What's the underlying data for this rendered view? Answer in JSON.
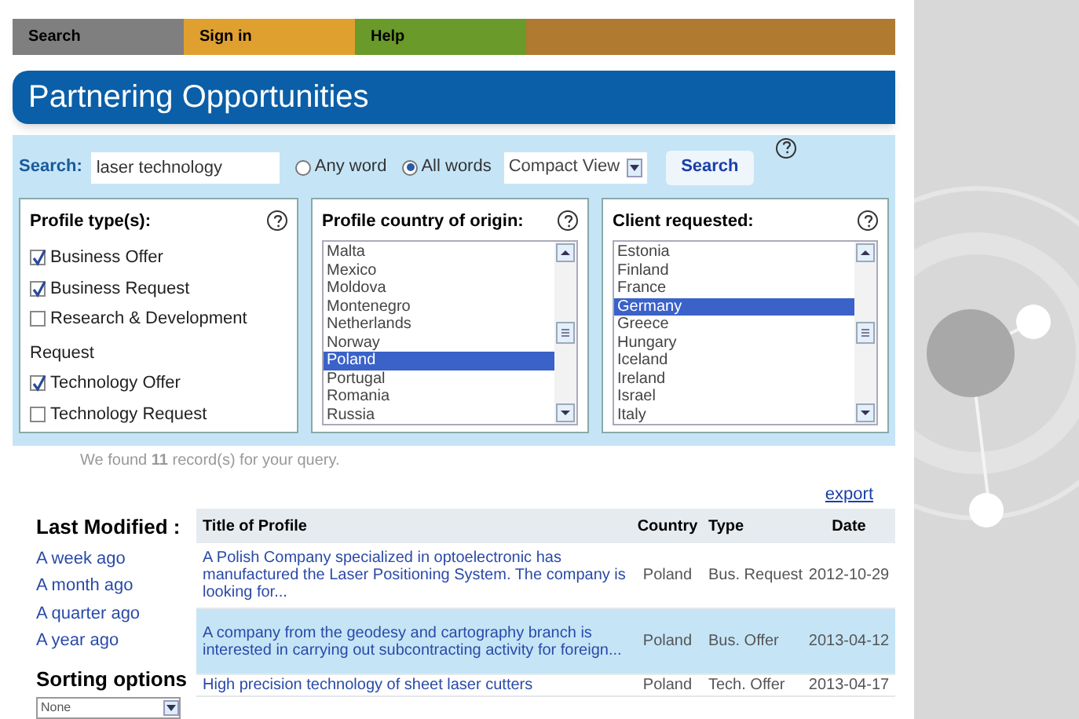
{
  "nav": [
    {
      "label": "Search",
      "kind": "search"
    },
    {
      "label": "Sign in",
      "kind": "signin"
    },
    {
      "label": "Help",
      "kind": "help"
    }
  ],
  "title": "Partnering Opportunities",
  "search": {
    "label": "Search:",
    "value": "laser technology",
    "modes": [
      {
        "label": "Any word",
        "selected": false
      },
      {
        "label": "All words",
        "selected": true
      }
    ],
    "view": "Compact View",
    "button": "Search"
  },
  "profile_types": {
    "title": "Profile type(s):",
    "items": [
      {
        "label": "Business Offer",
        "checked": true
      },
      {
        "label": "Business Request",
        "checked": true
      },
      {
        "label": "Research & Development",
        "checked": false
      },
      {
        "label": "Request",
        "kind": "heading"
      },
      {
        "label": "Technology Offer",
        "checked": true
      },
      {
        "label": "Technology Request",
        "checked": false
      }
    ]
  },
  "country_of_origin": {
    "title": "Profile country of origin:",
    "options": [
      {
        "label": "Malta",
        "selected": false
      },
      {
        "label": "Mexico",
        "selected": false
      },
      {
        "label": "Moldova",
        "selected": false
      },
      {
        "label": "Montenegro",
        "selected": false
      },
      {
        "label": "Netherlands",
        "selected": false
      },
      {
        "label": "Norway",
        "selected": false
      },
      {
        "label": "Poland",
        "selected": true
      },
      {
        "label": "Portugal",
        "selected": false
      },
      {
        "label": "Romania",
        "selected": false
      },
      {
        "label": "Russia",
        "selected": false
      }
    ]
  },
  "client_requested": {
    "title": "Client requested:",
    "options": [
      {
        "label": "Estonia",
        "selected": false
      },
      {
        "label": "Finland",
        "selected": false
      },
      {
        "label": "France",
        "selected": false
      },
      {
        "label": "Germany",
        "selected": true
      },
      {
        "label": "Greece",
        "selected": false
      },
      {
        "label": "Hungary",
        "selected": false
      },
      {
        "label": "Iceland",
        "selected": false
      },
      {
        "label": "Ireland",
        "selected": false
      },
      {
        "label": "Israel",
        "selected": false
      },
      {
        "label": "Italy",
        "selected": false
      }
    ]
  },
  "result_summary": "We found **11** record(s) for your query.",
  "export": "export",
  "last_modified": {
    "title": "Last Modified :",
    "links": [
      "A week ago",
      "A month ago",
      "A quarter ago",
      "A year ago"
    ]
  },
  "sorting": {
    "title": "Sorting options",
    "value": "None"
  },
  "table": {
    "columns": [
      "Title of Profile",
      "Country",
      "Type",
      "Date"
    ],
    "rows": [
      {
        "title": "A Polish Company specialized in optoelectronic has manufactured the Laser Positioning System. The company is looking for...",
        "country": "Poland",
        "type": "Bus. Request",
        "date": "2012-10-29",
        "selected": false
      },
      {
        "title": "A company from the geodesy and cartography branch is interested in carrying out subcontracting activity for foreign...",
        "country": "Poland",
        "type": "Bus. Offer",
        "date": "2013-04-12",
        "selected": true
      },
      {
        "title": "High precision technology of sheet laser cutters",
        "country": "Poland",
        "type": "Tech. Offer",
        "date": "2013-04-17",
        "selected": false
      }
    ]
  }
}
